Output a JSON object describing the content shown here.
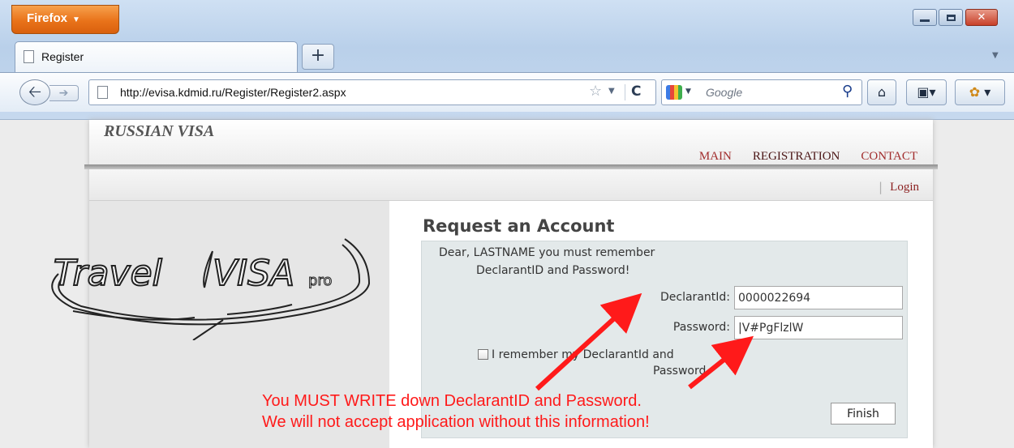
{
  "browser": {
    "menu_button": "Firefox",
    "tab_title": "Register",
    "new_tab": "+",
    "url": "http://evisa.kdmid.ru/Register/Register2.aspx",
    "search_placeholder": "Google",
    "icons": [
      "back-arrow-icon",
      "forward-arrow-icon",
      "page-icon",
      "star-icon",
      "reload-icon",
      "google-icon",
      "search-icon",
      "home-icon",
      "bookmarks-icon",
      "addon-icon"
    ]
  },
  "site": {
    "title": "RUSSIAN VISA",
    "nav": [
      "MAIN",
      "REGISTRATION",
      "CONTACT"
    ],
    "login_sep": "|",
    "login": "Login"
  },
  "logo": {
    "word1": "Travel",
    "word2": "VISA",
    "word3": "pro"
  },
  "form": {
    "title": "Request an Account",
    "message_line1": "Dear, LASTNAME you must remember",
    "message_line2": "DeclarantID and Password!",
    "declarant_label": "DeclarantId:",
    "declarant_value": "0000022694",
    "password_label": "Password:",
    "password_value": "|V#PgFlzlW",
    "remember_label_line1": "I remember my DeclarantId and",
    "remember_label_line2": "Password.",
    "remember_checked": false,
    "finish_button": "Finish"
  },
  "annotation": {
    "line1": "You MUST WRITE down DeclarantID and Password.",
    "line2": "We will not accept application without this information!",
    "color": "#ff1a1a"
  }
}
